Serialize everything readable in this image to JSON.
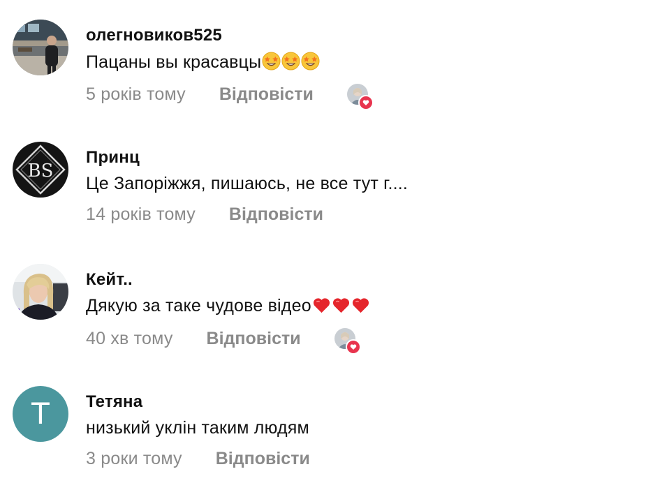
{
  "comments": [
    {
      "username": "олегновиков525",
      "text": "Пацаны вы красавцы",
      "time": "5 років тому",
      "reply_label": "Відповісти",
      "avatar_icon": "photo-avatar-man",
      "emoji": [
        "star-struck",
        "star-struck",
        "star-struck"
      ],
      "creator_liked": true
    },
    {
      "username": "Принц",
      "text": "Це Запоріжжя, пишаюсь, не все тут г....",
      "time": "14 років тому",
      "reply_label": "Відповісти",
      "avatar_icon": "bs-logo-avatar",
      "avatar_logo_text": "BS",
      "creator_liked": false
    },
    {
      "username": "Кейт..",
      "text": "Дякую за таке чудове відео",
      "time": "40 хв тому",
      "reply_label": "Відповісти",
      "avatar_icon": "photo-avatar-woman",
      "emoji": [
        "red-heart",
        "red-heart",
        "red-heart"
      ],
      "creator_liked": true
    },
    {
      "username": "Тетяна",
      "text": "низький уклін таким людям",
      "time": "3 роки тому",
      "reply_label": "Відповісти",
      "avatar_icon": "letter-avatar",
      "avatar_letter": "T",
      "avatar_color": "#4b979e",
      "creator_liked": false
    }
  ],
  "colors": {
    "text": "#111111",
    "meta": "#8a8a8a",
    "heart_badge": "#e8344e"
  }
}
